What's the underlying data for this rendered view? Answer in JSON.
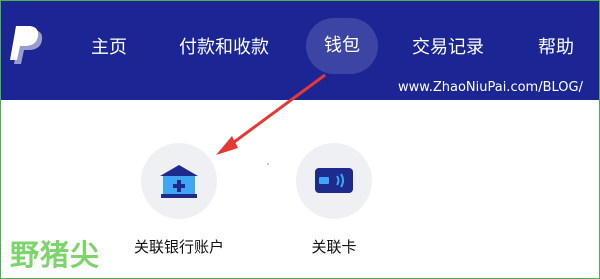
{
  "nav": {
    "items": [
      {
        "label": "主页"
      },
      {
        "label": "付款和收款"
      },
      {
        "label": "钱包"
      },
      {
        "label": "交易记录"
      },
      {
        "label": "帮助"
      }
    ],
    "active_item": "钱包"
  },
  "watermark": {
    "url": "www.ZhaoNiuPai.com/BLOG/",
    "brand": "野猪尖"
  },
  "actions": {
    "link_bank": {
      "label": "关联银行账户",
      "icon": "bank-icon"
    },
    "link_card": {
      "label": "关联卡",
      "icon": "credit-card-icon"
    }
  },
  "colors": {
    "navbar": "#1c2594",
    "icon_blue": "#1e2b8c",
    "icon_light_blue": "#3fa5f5",
    "arrow_red": "#e53935",
    "watermark_green": "#7ed46c"
  }
}
